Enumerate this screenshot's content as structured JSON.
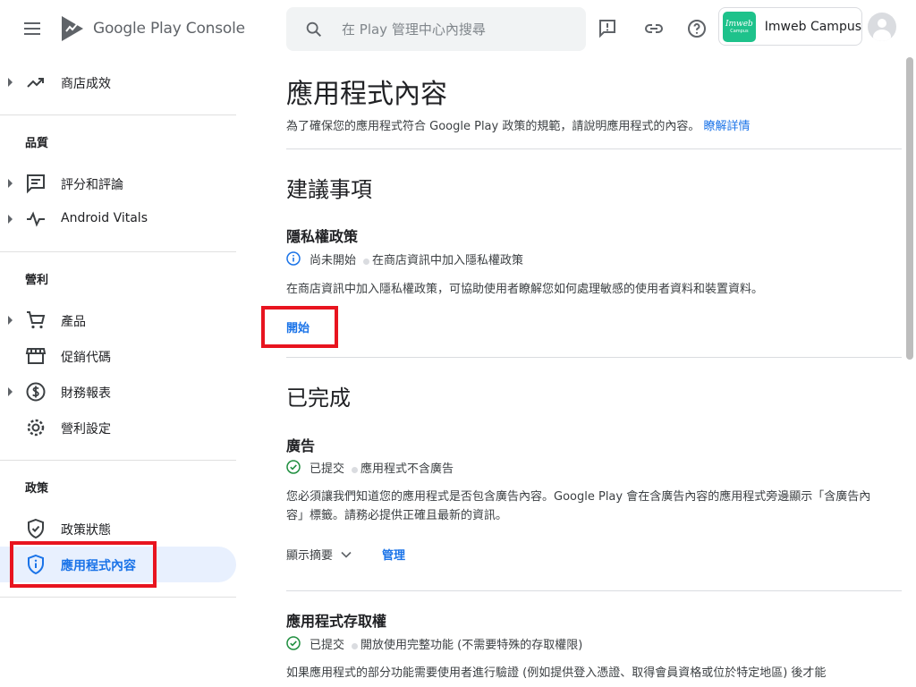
{
  "header": {
    "logo_text": "Google Play Console",
    "search_placeholder": "在 Play 管理中心內搜尋",
    "account_name": "Imweb Campus",
    "account_logo_line1": "Imweb",
    "account_logo_line2": "Campus"
  },
  "sidebar": {
    "items": [
      {
        "label": "商店成效",
        "icon": "trending-up-icon"
      },
      {
        "label": "評分和評論",
        "icon": "reviews-icon"
      },
      {
        "label": "Android Vitals",
        "icon": "vitals-icon"
      },
      {
        "label": "產品",
        "icon": "cart-icon"
      },
      {
        "label": "促銷代碼",
        "icon": "store-icon"
      },
      {
        "label": "財務報表",
        "icon": "dollar-icon"
      },
      {
        "label": "營利設定",
        "icon": "gear-icon"
      },
      {
        "label": "政策狀態",
        "icon": "shield-check-icon"
      },
      {
        "label": "應用程式內容",
        "icon": "shield-info-icon"
      }
    ],
    "sections": {
      "quality": "品質",
      "monetize": "營利",
      "policy": "政策"
    }
  },
  "main": {
    "title": "應用程式內容",
    "description": "為了確保您的應用程式符合 Google Play 政策的規範，請說明應用程式的內容。",
    "learn_more": "瞭解詳情",
    "recommended_title": "建議事項",
    "privacy": {
      "title": "隱私權政策",
      "status": "尚未開始",
      "status_detail": "在商店資訊中加入隱私權政策",
      "body": "在商店資訊中加入隱私權政策，可協助使用者瞭解您如何處理敏感的使用者資料和裝置資料。",
      "action": "開始"
    },
    "completed_title": "已完成",
    "ads": {
      "title": "廣告",
      "status": "已提交",
      "status_detail": "應用程式不含廣告",
      "body": "您必須讓我們知道您的應用程式是否包含廣告內容。Google Play 會在含廣告內容的應用程式旁邊顯示「含廣告內容」標籤。請務必提供正確且最新的資訊。",
      "summary": "顯示摘要",
      "manage": "管理"
    },
    "access": {
      "title": "應用程式存取權",
      "status": "已提交",
      "status_detail": "開放使用完整功能 (不需要特殊的存取權限)",
      "body": "如果應用程式的部分功能需要使用者進行驗證 (例如提供登入憑證、取得會員資格或位於特定地區) 後才能"
    }
  },
  "colors": {
    "accent": "#1a73e8",
    "highlight": "#e8141f",
    "success": "#1e8e3e",
    "active_bg": "#e8f0fe"
  }
}
